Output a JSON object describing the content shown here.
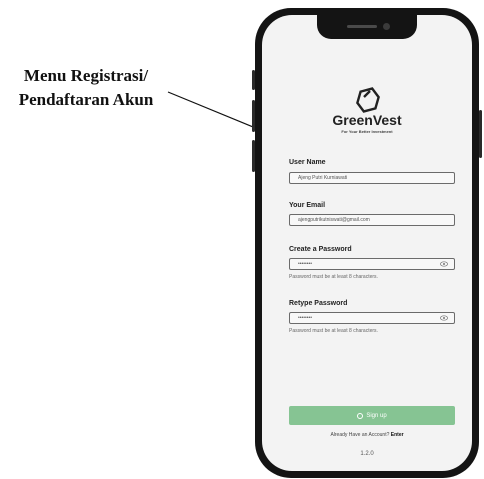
{
  "annotation": {
    "line1": "Menu Registrasi/",
    "line2": "Pendaftaran Akun"
  },
  "app": {
    "brand": "GreenVest",
    "tagline": "For Your Better Investment",
    "accent": "#86c493"
  },
  "form": {
    "username_label": "User Name",
    "username_value": "Ajeng Putri Kurniawati",
    "email_label": "Your Email",
    "email_value": "ajengputrikutniswati@gmail.com",
    "password_label": "Create a Password",
    "password_value": "••••••••",
    "password_hint": "Password must be at least 8 characters.",
    "retype_label": "Retype Password",
    "retype_value": "••••••••",
    "retype_hint": "Password must be at least 8 characters."
  },
  "actions": {
    "signup_label": "Sign up",
    "already_text": "Already Have an Account?",
    "enter_label": "Enter"
  },
  "footer": {
    "version": "1.2.0"
  },
  "icons": [
    "logo-icon",
    "eye-icon",
    "signup-icon"
  ]
}
